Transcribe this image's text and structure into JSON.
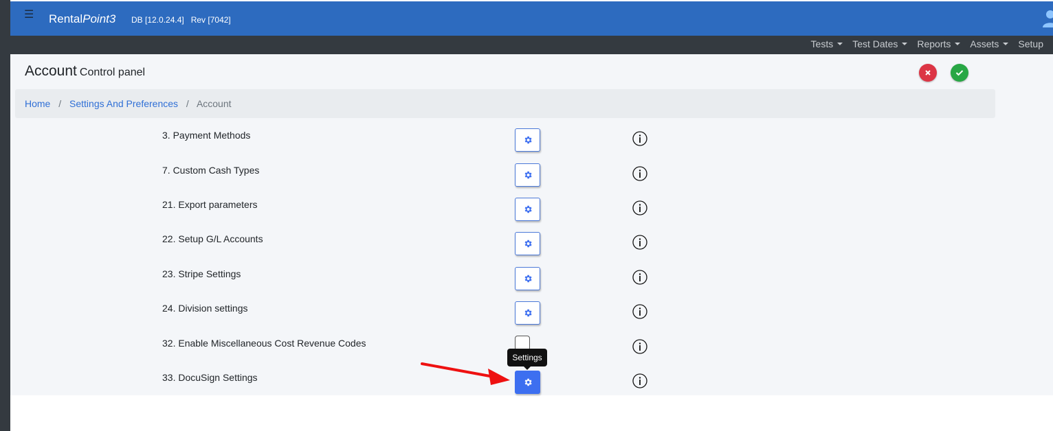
{
  "app": {
    "brand_prefix": "Rental",
    "brand_suffix": "Point3",
    "db_info": "DB [12.0.24.4]   Rev [7042]"
  },
  "nav": {
    "items": [
      {
        "label": "Tests",
        "has_caret": true
      },
      {
        "label": "Test Dates",
        "has_caret": true
      },
      {
        "label": "Reports",
        "has_caret": true
      },
      {
        "label": "Assets",
        "has_caret": true
      },
      {
        "label": "Setup",
        "has_caret": false
      }
    ]
  },
  "page": {
    "title": "Account",
    "subtitle": "Control panel",
    "cancel_icon": "close-icon",
    "confirm_icon": "check-icon"
  },
  "breadcrumb": {
    "items": [
      "Home",
      "Settings And Preferences",
      "Account"
    ],
    "separator": "/"
  },
  "settings": {
    "rows": [
      {
        "label": "3. Payment Methods",
        "control": "gear-button"
      },
      {
        "label": "7. Custom Cash Types",
        "control": "gear-button"
      },
      {
        "label": "21. Export parameters",
        "control": "gear-button"
      },
      {
        "label": "22. Setup G/L Accounts",
        "control": "gear-button"
      },
      {
        "label": "23. Stripe Settings",
        "control": "gear-button"
      },
      {
        "label": "24. Division settings",
        "control": "gear-button"
      },
      {
        "label": "32. Enable Miscellaneous Cost Revenue Codes",
        "control": "checkbox",
        "checked": false
      },
      {
        "label": "33. DocuSign Settings",
        "control": "gear-button",
        "hovered": true
      }
    ]
  },
  "tooltip": {
    "text": "Settings"
  },
  "colors": {
    "topbar": "#2d6bbf",
    "navbar": "#343a40",
    "link": "#2f6fd6",
    "gear": "#3d6ff0",
    "cancel": "#dc3545",
    "confirm": "#28a745",
    "annotation_arrow": "#ee1111"
  }
}
